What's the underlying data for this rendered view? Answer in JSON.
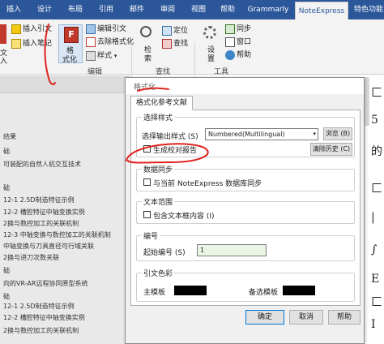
{
  "tabs": [
    "插入",
    "设计",
    "布局",
    "引用",
    "邮件",
    "审阅",
    "视图",
    "帮助",
    "Grammarly",
    "NoteExpress",
    "特色功能"
  ],
  "ribbon": {
    "insert_citation": "插入引文",
    "insert_note": "插入笔记",
    "format_label": "格\n式化",
    "format_line1": "格",
    "format_line2": "式化",
    "edit_citation": "编辑引文",
    "remove_format": "去除格式化",
    "style": "样式",
    "search": "检\n索",
    "search_line1": "检",
    "search_line2": "索",
    "locate": "定位",
    "find": "查找",
    "settings_line1": "设",
    "settings_line2": "置",
    "sync": "同步",
    "window": "窗口",
    "help": "帮助",
    "group_edit": "编辑",
    "group_find": "查找",
    "group_tools": "工具",
    "left_fragment": "文",
    "left_fragment2": "入"
  },
  "nav_items": [
    "结果",
    "础",
    "可装配的自然人机交互技术",
    "",
    "",
    "础",
    "12-1 2.5D制造特征示例",
    "12-2 槽腔特征中轴变换实例",
    "2换与数控加工的关联机制",
    "12-3 中轴变换与数控加工的关联机制",
    "中轴变换与刀具直径可行域关联",
    "2换与进刀次数关联",
    "础",
    "向的VR-AR远程协同原型系统",
    "础",
    "12-1 2.5D制造特征示例",
    "12-2 槽腔特征中轴变换实例",
    "2换与数控加工的关联机制"
  ],
  "right_glyphs": [
    "匚",
    "5",
    "的",
    "匚",
    "|",
    "∫",
    "E",
    "匚",
    "I"
  ],
  "dialog": {
    "title": "格式化",
    "tab": "格式化参考文献",
    "section_style": "选择样式",
    "output_style_label": "选择输出样式 (S)",
    "output_style_value": "Numbered(Multilingual)",
    "browse_button": "浏览 (B)",
    "generate_report": "生成校对报告",
    "clear_history": "清除历史 (C)",
    "section_sync": "数据同步",
    "sync_option": "与当前 NoteExpress 数据库同步",
    "section_text_range": "文本范围",
    "include_textbox": "包含文本框内容 (I)",
    "section_numbering": "编号",
    "start_number_label": "起始编号 (S)",
    "start_number_value": "1",
    "section_color": "引文色彩",
    "primary_label": "主模板",
    "alternate_label": "备选模板",
    "primary_color": "#000000",
    "alternate_color": "#000000",
    "ok": "确定",
    "cancel": "取消",
    "apply": "应用",
    "help": "帮助"
  },
  "colors": {
    "tabbar": "#2b579a",
    "annotation": "#e0221f",
    "format_icon": "#c0392b"
  }
}
